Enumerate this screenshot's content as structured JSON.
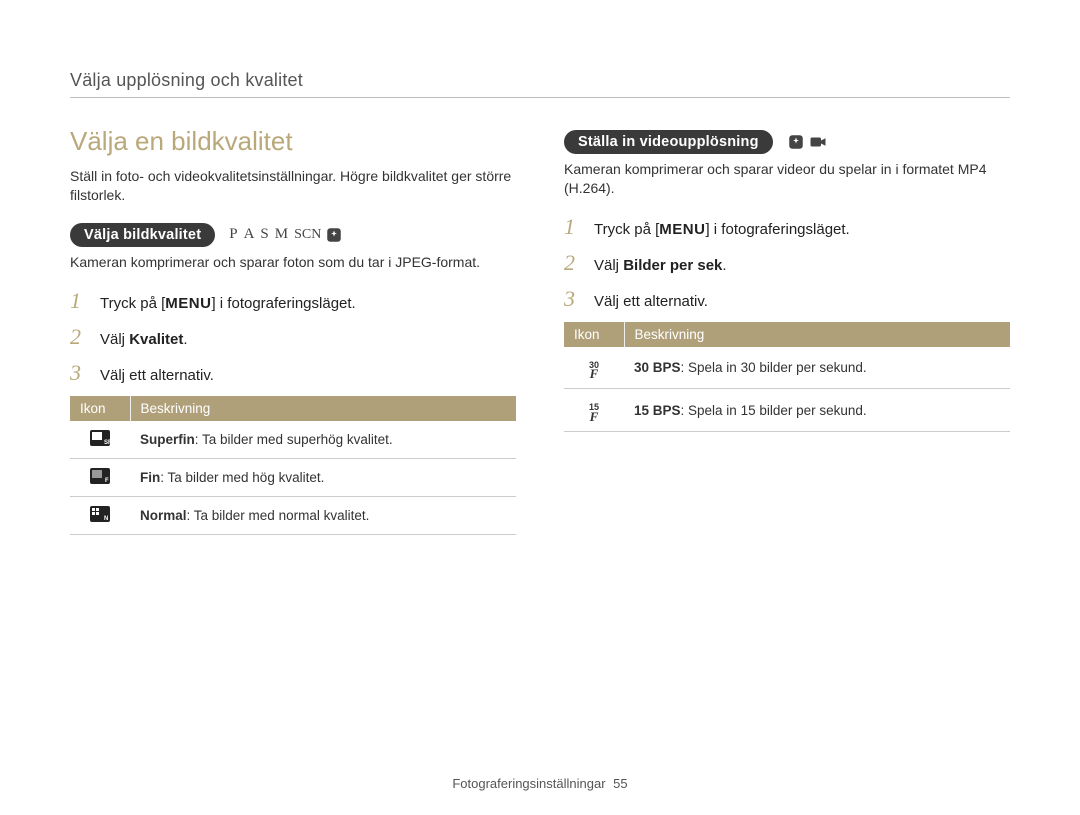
{
  "page_header": "Välja upplösning och kvalitet",
  "main_title": "Välja en bildkvalitet",
  "intro": "Ställ in foto- och videokvalitetsinställningar. Högre bildkvalitet ger större filstorlek.",
  "left": {
    "pill": "Välja bildkvalitet",
    "modes": [
      "P",
      "A",
      "S",
      "M",
      "SCN"
    ],
    "mode_extra_icon": "magic-icon",
    "subtext": "Kameran komprimerar och sparar foton som du tar i JPEG-format.",
    "steps": [
      {
        "num": "1",
        "pre": "Tryck på [",
        "menu": "MENU",
        "post": "] i fotograferingsläget."
      },
      {
        "num": "2",
        "pre": "Välj ",
        "bold": "Kvalitet",
        "post": "."
      },
      {
        "num": "3",
        "pre": "Välj ett alternativ.",
        "bold": "",
        "post": ""
      }
    ],
    "table": {
      "headers": [
        "Ikon",
        "Beskrivning"
      ],
      "rows": [
        {
          "icon": "superfine-icon",
          "bold": "Superfin",
          "rest": ": Ta bilder med superhög kvalitet."
        },
        {
          "icon": "fine-icon",
          "bold": "Fin",
          "rest": ": Ta bilder med hög kvalitet."
        },
        {
          "icon": "normal-icon",
          "bold": "Normal",
          "rest": ": Ta bilder med normal kvalitet."
        }
      ]
    }
  },
  "right": {
    "pill": "Ställa in videoupplösning",
    "mode_icons": [
      "magic-icon",
      "video-icon"
    ],
    "subtext": "Kameran komprimerar och sparar videor du spelar in i formatet MP4 (H.264).",
    "steps": [
      {
        "num": "1",
        "pre": "Tryck på [",
        "menu": "MENU",
        "post": "] i fotograferingsläget."
      },
      {
        "num": "2",
        "pre": "Välj ",
        "bold": "Bilder per sek",
        "post": "."
      },
      {
        "num": "3",
        "pre": "Välj ett alternativ.",
        "bold": "",
        "post": ""
      }
    ],
    "table": {
      "headers": [
        "Ikon",
        "Beskrivning"
      ],
      "rows": [
        {
          "icon": "30",
          "bold": "30 BPS",
          "rest": ": Spela in 30 bilder per sekund."
        },
        {
          "icon": "15",
          "bold": "15 BPS",
          "rest": ": Spela in 15 bilder per sekund."
        }
      ]
    }
  },
  "footer": {
    "section": "Fotograferingsinställningar",
    "page": "55"
  }
}
